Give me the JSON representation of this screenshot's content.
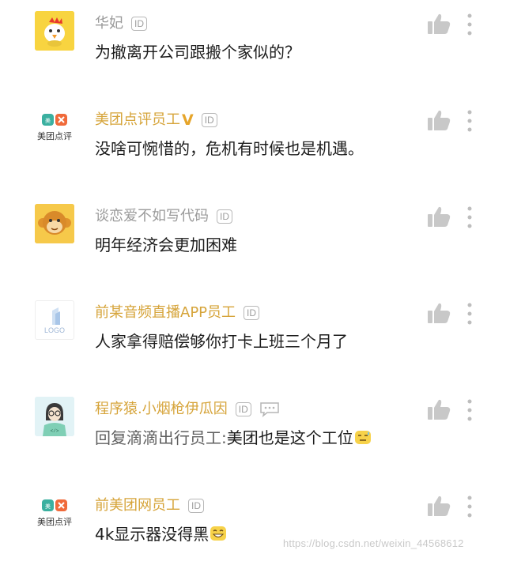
{
  "comments": [
    {
      "name": "华妃",
      "id_badge": "ID",
      "text": "为撤离开公司跟搬个家似的？"
    },
    {
      "name": "美团点评员工",
      "id_badge": "ID",
      "text": "没啥可惋惜的，危机有时候也是机遇。",
      "avatar_label": "美团点评"
    },
    {
      "name": "谈恋爱不如写代码",
      "id_badge": "ID",
      "text": "明年经济会更加困难"
    },
    {
      "name": "前某音频直播APP员工",
      "id_badge": "ID",
      "text": "人家拿得赔偿够你打卡上班三个月了",
      "avatar_label": "LOGO"
    },
    {
      "name": "程序猿.小烟枪伊瓜因",
      "id_badge": "ID",
      "text_prefix": "回复滴滴出行员工:",
      "text": "美团也是这个工位"
    },
    {
      "name": "前美团网员工",
      "id_badge": "ID",
      "text": "4k显示器没得黑",
      "avatar_label": "美团点评"
    }
  ],
  "watermark": "https://blog.csdn.net/weixin_44568612",
  "colors": {
    "gold": "#d6a43a",
    "gray": "#9a9a9a",
    "icon": "#c8c8c8"
  }
}
